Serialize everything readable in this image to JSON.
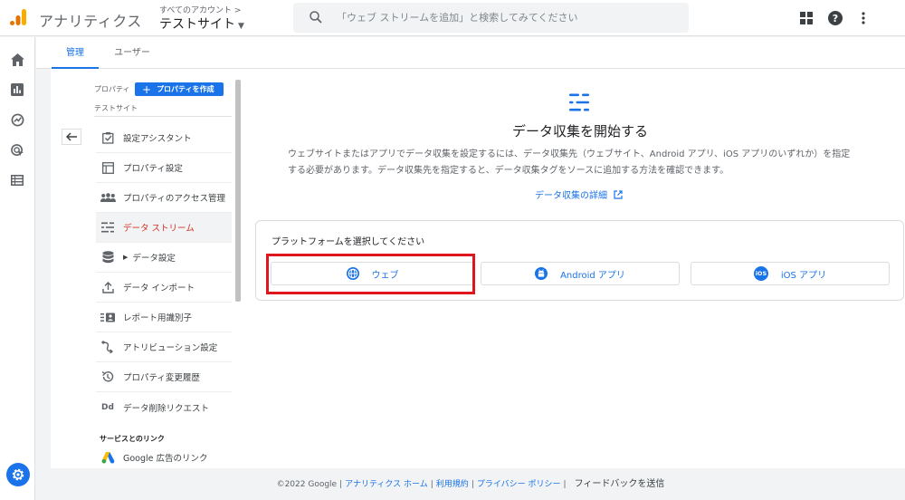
{
  "header": {
    "app_name": "アナリティクス",
    "account_label": "すべてのアカウント",
    "account_chevron": ">",
    "site_name": "テストサイト",
    "search_placeholder": "「ウェブ ストリームを追加」と検索してみてください"
  },
  "tabs": [
    {
      "label": "管理",
      "active": true
    },
    {
      "label": "ユーザー",
      "active": false
    }
  ],
  "panel": {
    "property_label": "プロパティ",
    "create_button": "プロパティを作成",
    "property_name": "テストサイト",
    "items": [
      {
        "label": "設定アシスタント",
        "icon": "checkbox-icon"
      },
      {
        "label": "プロパティ設定",
        "icon": "layout-icon"
      },
      {
        "label": "プロパティのアクセス管理",
        "icon": "people-icon"
      },
      {
        "label": "データ ストリーム",
        "icon": "streams-icon",
        "active": true
      },
      {
        "label": "データ設定",
        "icon": "database-icon",
        "expandable": true
      },
      {
        "label": "データ インポート",
        "icon": "upload-icon"
      },
      {
        "label": "レポート用識別子",
        "icon": "identity-icon"
      },
      {
        "label": "アトリビューション設定",
        "icon": "attribution-icon"
      },
      {
        "label": "プロパティ変更履歴",
        "icon": "history-icon"
      },
      {
        "label": "データ削除リクエスト",
        "icon": "dd-icon",
        "icon_text": "Dd"
      }
    ],
    "links_section_title": "サービスとのリンク",
    "links": [
      {
        "label": "Google 広告のリンク",
        "icon": "google-ads-icon"
      }
    ]
  },
  "main": {
    "title": "データ収集を開始する",
    "description": "ウェブサイトまたはアプリでデータ収集を設定するには、データ収集先（ウェブサイト、Android アプリ、iOS アプリのいずれか）を指定する必要があります。データ収集先を指定すると、データ収集タグをソースに追加する方法を確認できます。",
    "detail_link": "データ収集の詳細",
    "platform_prompt": "プラットフォームを選択してください",
    "platforms": [
      {
        "label": "ウェブ",
        "icon": "globe-icon"
      },
      {
        "label": "Android アプリ",
        "icon": "android-icon"
      },
      {
        "label": "iOS アプリ",
        "icon": "ios-icon",
        "icon_text": "iOS"
      }
    ]
  },
  "footer": {
    "copyright": "©2022 Google",
    "separator": "|",
    "links": [
      "アナリティクス ホーム",
      "利用規約",
      "プライバシー ポリシー"
    ],
    "feedback": "フィードバックを送信"
  },
  "colors": {
    "accent": "#1a73e8",
    "active_nav_text": "#d93025",
    "highlight_border": "#e0161e",
    "logo_orange": "#f9ab00",
    "logo_dark_orange": "#e37400"
  }
}
